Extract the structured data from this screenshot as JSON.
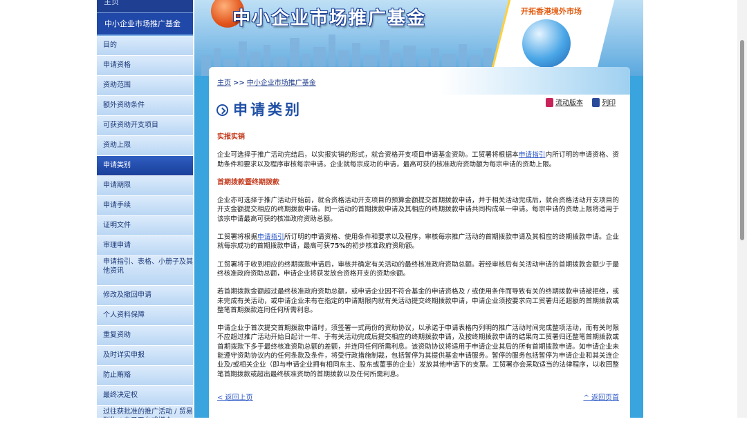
{
  "sidebar": {
    "top_label": "主页",
    "header": "中小企业市场推广基金",
    "items": [
      {
        "label": "目的"
      },
      {
        "label": "申请资格"
      },
      {
        "label": "资助范围"
      },
      {
        "label": "额外资助条件"
      },
      {
        "label": "可获资助开支项目"
      },
      {
        "label": "资助上限"
      },
      {
        "label": "申请类别"
      },
      {
        "label": "申请期限"
      },
      {
        "label": "申请手续"
      },
      {
        "label": "证明文件"
      },
      {
        "label": "审理申请"
      },
      {
        "label": "申请指引、表格、小册子及其他资讯"
      },
      {
        "label": "修改及撤回申请"
      },
      {
        "label": "个人资料保障"
      },
      {
        "label": "重复资助"
      },
      {
        "label": "及时详实申报"
      },
      {
        "label": "防止贿赂"
      },
      {
        "label": "最终决定权"
      },
      {
        "label": "过往获批准的推广活动 / 贸易刊物 / 电子平台或媒介"
      }
    ]
  },
  "banner": {
    "title": "中小企业市场推广基金",
    "intl_text": "开拓香港境外市场"
  },
  "breadcrumb": {
    "home": "主页",
    "sep": ">>",
    "current": "中小企业市场推广基金"
  },
  "page": {
    "title": "申请类别"
  },
  "tools": {
    "mobile": "流动版本",
    "print": "列印"
  },
  "content": {
    "h1": "实报实销",
    "p1_a": "企业可选择于推广活动完结后，以实报实销的形式，就合资格开支项目申请基金资助。工贸署将根据本",
    "p1_link": "申请指引",
    "p1_b": "内所订明的申请资格、资助条件和要求以及程序审核每宗申请。企业就每宗成功的申请，最高可获的核准政府资助额为每宗申请的资助上限。",
    "h2": "首期拨款暨终期拨款",
    "p2": "企业亦可选择于推广活动开始前，就合资格活动开支项目的预算金额提交首期拨款申请，并于相关活动完成后，就合资格活动开支项目的开支金额提交相应的终期拨款申请。同一活动的首期拨款申请及其相应的终期拨款申请共同构成单一申请。每宗申请的资助上限将适用于该宗申请最高可获的核准政府资助总额。",
    "p3_a": "工贸署将根据",
    "p3_link": "申请指引",
    "p3_b": "所订明的申请资格、使用条件和要求以及程序，审核每宗推广活动的首期拨款申请及其相应的终期拨款申请。企业就每宗成功的首期拨款申请，最高可获",
    "p3_pct": "75%",
    "p3_c": "的初步核准政府资助额。",
    "p4": "工贸署将于收到相应的终期拨款申请后，审核并确定有关活动的最终核准政府资助总额。若经审核后有关活动申请的首期拨款金额少于最终核准政府资助总额，申请企业将获发放合资格开支的资助余额。",
    "p5": "若首期拨款金额超过最终核准政府资助总额，或申请企业因不符合基金的申请资格及 / 或使用条件而导致有关的终期拨款申请被拒绝，或未完成有关活动，或申请企业未有在指定的申请期限内就有关活动提交终期拨款申请，申请企业须按要求向工贸署归还超额的首期拨款或整笔首期拨款连同任何所需利息。",
    "p6": "申请企业于首次提交首期拨款申请时，须签署一式两份的资助协议，以承诺于申请表格内列明的推广活动时间完成整项活动，而有关时限不应超过推广活动开始日起计一年、于有关活动完成后提交相应的终期拨款申请，及按终期拨款申请的结果向工贸署归还整笔首期拨款或首期拨款下多于最终核准资助总额的差额，并连同任何所需利息。该资助协议将适用于申请企业其后的所有首期拨款申请。如申请企业未能遵守资助协议内的任何条款及条件，将受行政措施制裁，包括暂停为其提供基金申请服务。暂停的服务包括暂停为申请企业和其关连企业及/或相关企业（即与申请企业拥有相同东主、股东或董事的企业）发放其他申请下的支票。工贸署亦会采取适当的法律程序，以收回整笔首期拨款或超出最终核准资助的首期拨款以及任何所需利息。"
  },
  "back": {
    "prev": "< 返回上页",
    "top": "^ 返回页首"
  },
  "colors": {
    "accent_blue": "#1f4fa5",
    "heading_red": "#c43b1d",
    "link_blue": "#2d58c7",
    "sidebar_active": "#1a3f99",
    "panel_bg": "#39a4dd"
  }
}
